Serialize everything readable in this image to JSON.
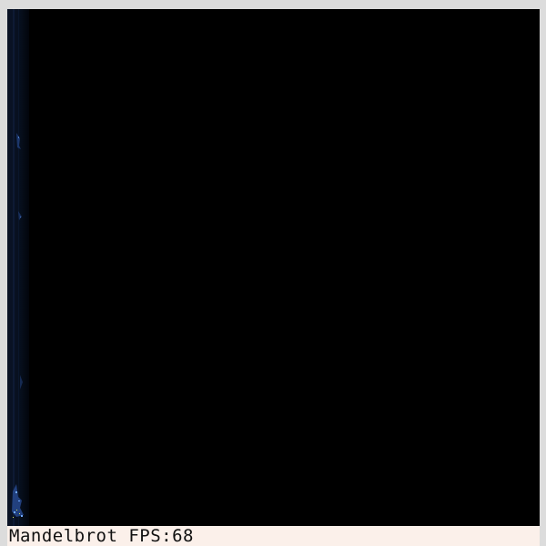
{
  "app": {
    "status_text": "Mandelbrot FPS:68"
  },
  "colors": {
    "background": "#000000",
    "frame": "#dcdcdc",
    "status_bar": "#fbf0ea",
    "fractal_edge": "#2a4f9a",
    "fractal_highlight": "#6fa8ff"
  }
}
